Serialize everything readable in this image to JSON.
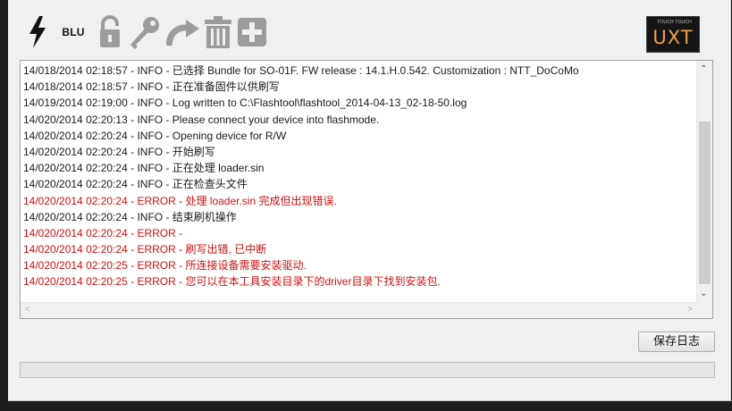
{
  "toolbar": {
    "flash_icon": "lightning-icon",
    "blu_label": "BLU",
    "lock_icon": "unlock-icon",
    "key_icon": "key-icon",
    "redo_icon": "redo-arrow-icon",
    "trash_icon": "trash-icon",
    "add_icon": "plus-icon",
    "logo_text": "UXT",
    "logo_small": "TOUCH TOUCH"
  },
  "log": {
    "lines": [
      {
        "text": "14/018/2014 02:18:57 - INFO  - 已选择 Bundle for SO-01F. FW release : 14.1.H.0.542. Customization : NTT_DoCoMo",
        "level": "info"
      },
      {
        "text": "14/018/2014 02:18:57 - INFO  - 正在准备固件以供刷写",
        "level": "info"
      },
      {
        "text": "14/019/2014 02:19:00 - INFO  - Log written to C:\\Flashtool\\flashtool_2014-04-13_02-18-50.log",
        "level": "info"
      },
      {
        "text": "14/020/2014 02:20:13 - INFO  - Please connect your device into flashmode.",
        "level": "info"
      },
      {
        "text": "14/020/2014 02:20:24 - INFO  - Opening device for R/W",
        "level": "info"
      },
      {
        "text": "14/020/2014 02:20:24 - INFO  - 开始刷写",
        "level": "info"
      },
      {
        "text": "14/020/2014 02:20:24 - INFO  - 正在处理 loader.sin",
        "level": "info"
      },
      {
        "text": "14/020/2014 02:20:24 - INFO  -     正在检查头文件",
        "level": "info"
      },
      {
        "text": "14/020/2014 02:20:24 - ERROR - 处理 loader.sin 完成但出现错误.",
        "level": "error"
      },
      {
        "text": "14/020/2014 02:20:24 - INFO  - 结束刷机操作",
        "level": "info"
      },
      {
        "text": "14/020/2014 02:20:24 - ERROR - ",
        "level": "error"
      },
      {
        "text": "14/020/2014 02:20:24 - ERROR - 刷写出错, 已中断",
        "level": "error"
      },
      {
        "text": "14/020/2014 02:20:25 - ERROR - 所连接设备需要安装驱动.",
        "level": "error"
      },
      {
        "text": "14/020/2014 02:20:25 - ERROR - 您可以在本工具安装目录下的driver目录下找到安装包.",
        "level": "error"
      }
    ]
  },
  "actions": {
    "save_log_label": "保存日志"
  },
  "progress": {
    "value": 0
  },
  "colors": {
    "error": "#cc1111",
    "info": "#1a1a1a",
    "logo_accent": "#f0a048",
    "disabled_icon": "#9c9c9c"
  }
}
